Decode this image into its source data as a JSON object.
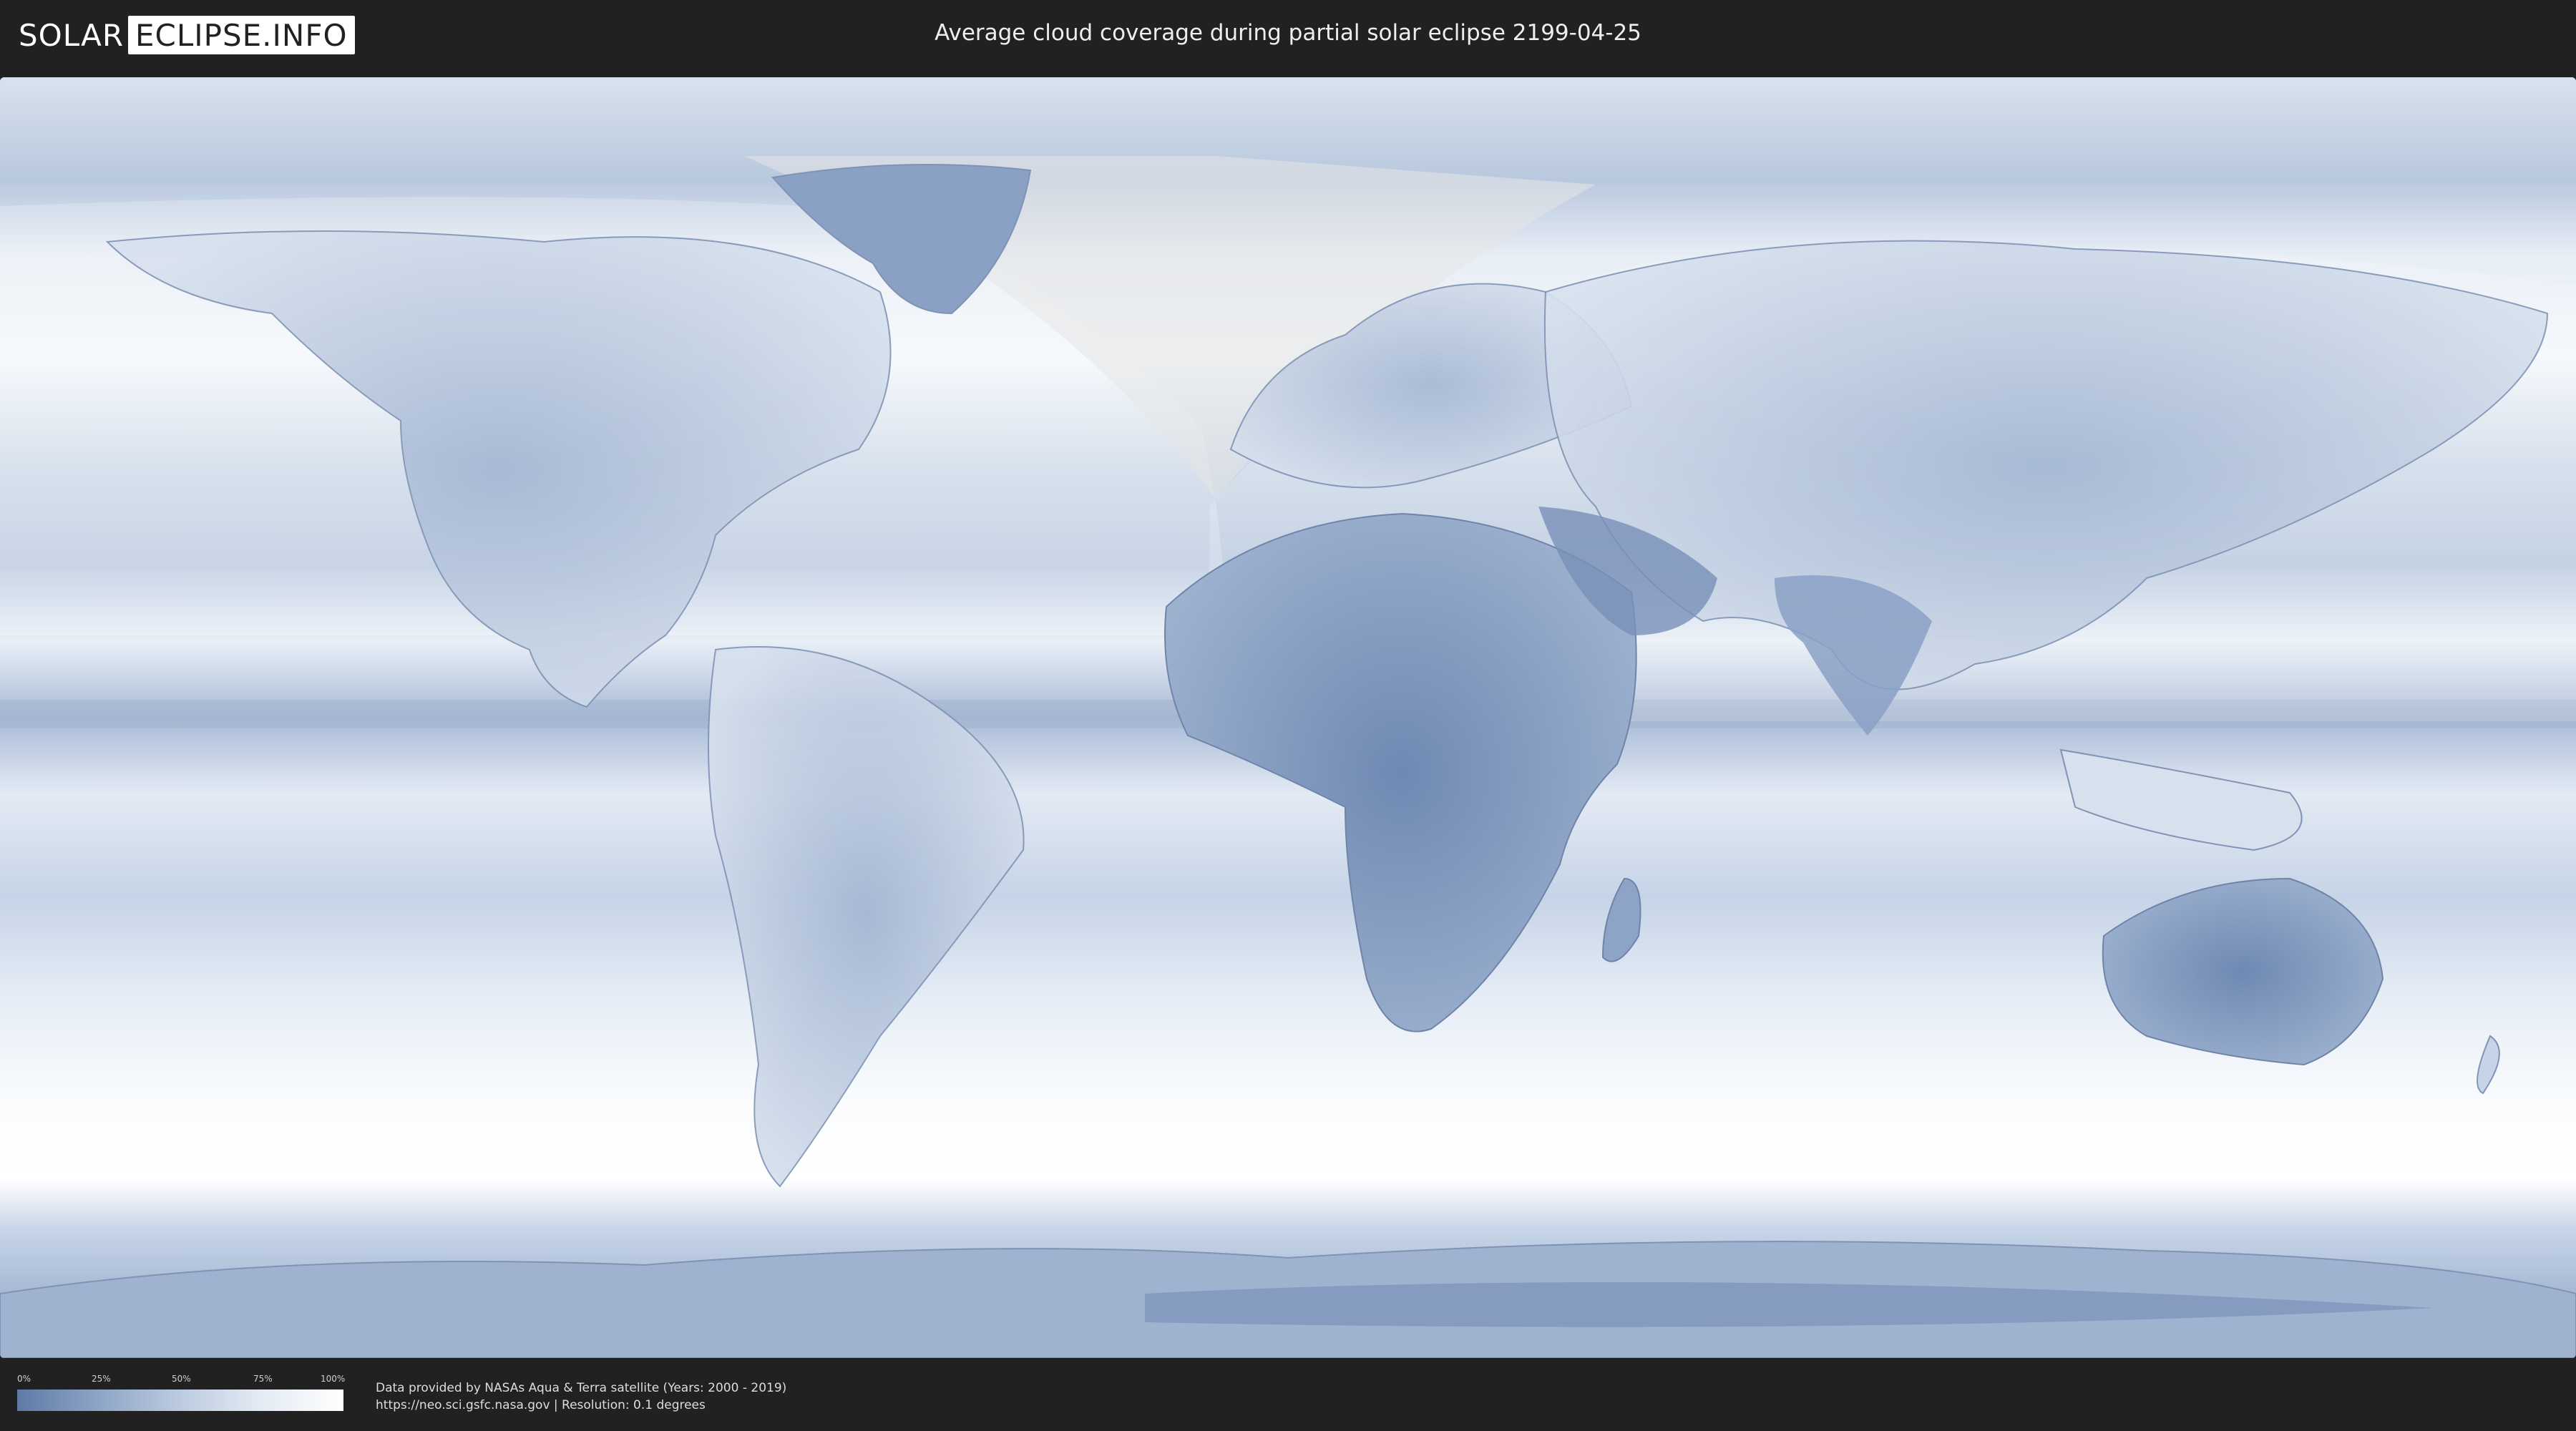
{
  "header": {
    "logo_left": "SOLAR",
    "logo_right": "ECLIPSE.INFO",
    "title": "Average cloud coverage during partial solar eclipse 2199-04-25"
  },
  "map": {
    "ocean_tint": "#c9d6e8",
    "clear_sky_color": "#5f7aa6",
    "cloudy_color": "#ffffff",
    "eclipse_zone_color": "#ffffff"
  },
  "legend": {
    "ticks": [
      "0%",
      "25%",
      "50%",
      "75%",
      "100%"
    ]
  },
  "credits": {
    "line1": "Data provided by NASAs Aqua & Terra satellite (Years: 2000 - 2019)",
    "line2": "https://neo.sci.gsfc.nasa.gov | Resolution: 0.1 degrees"
  }
}
